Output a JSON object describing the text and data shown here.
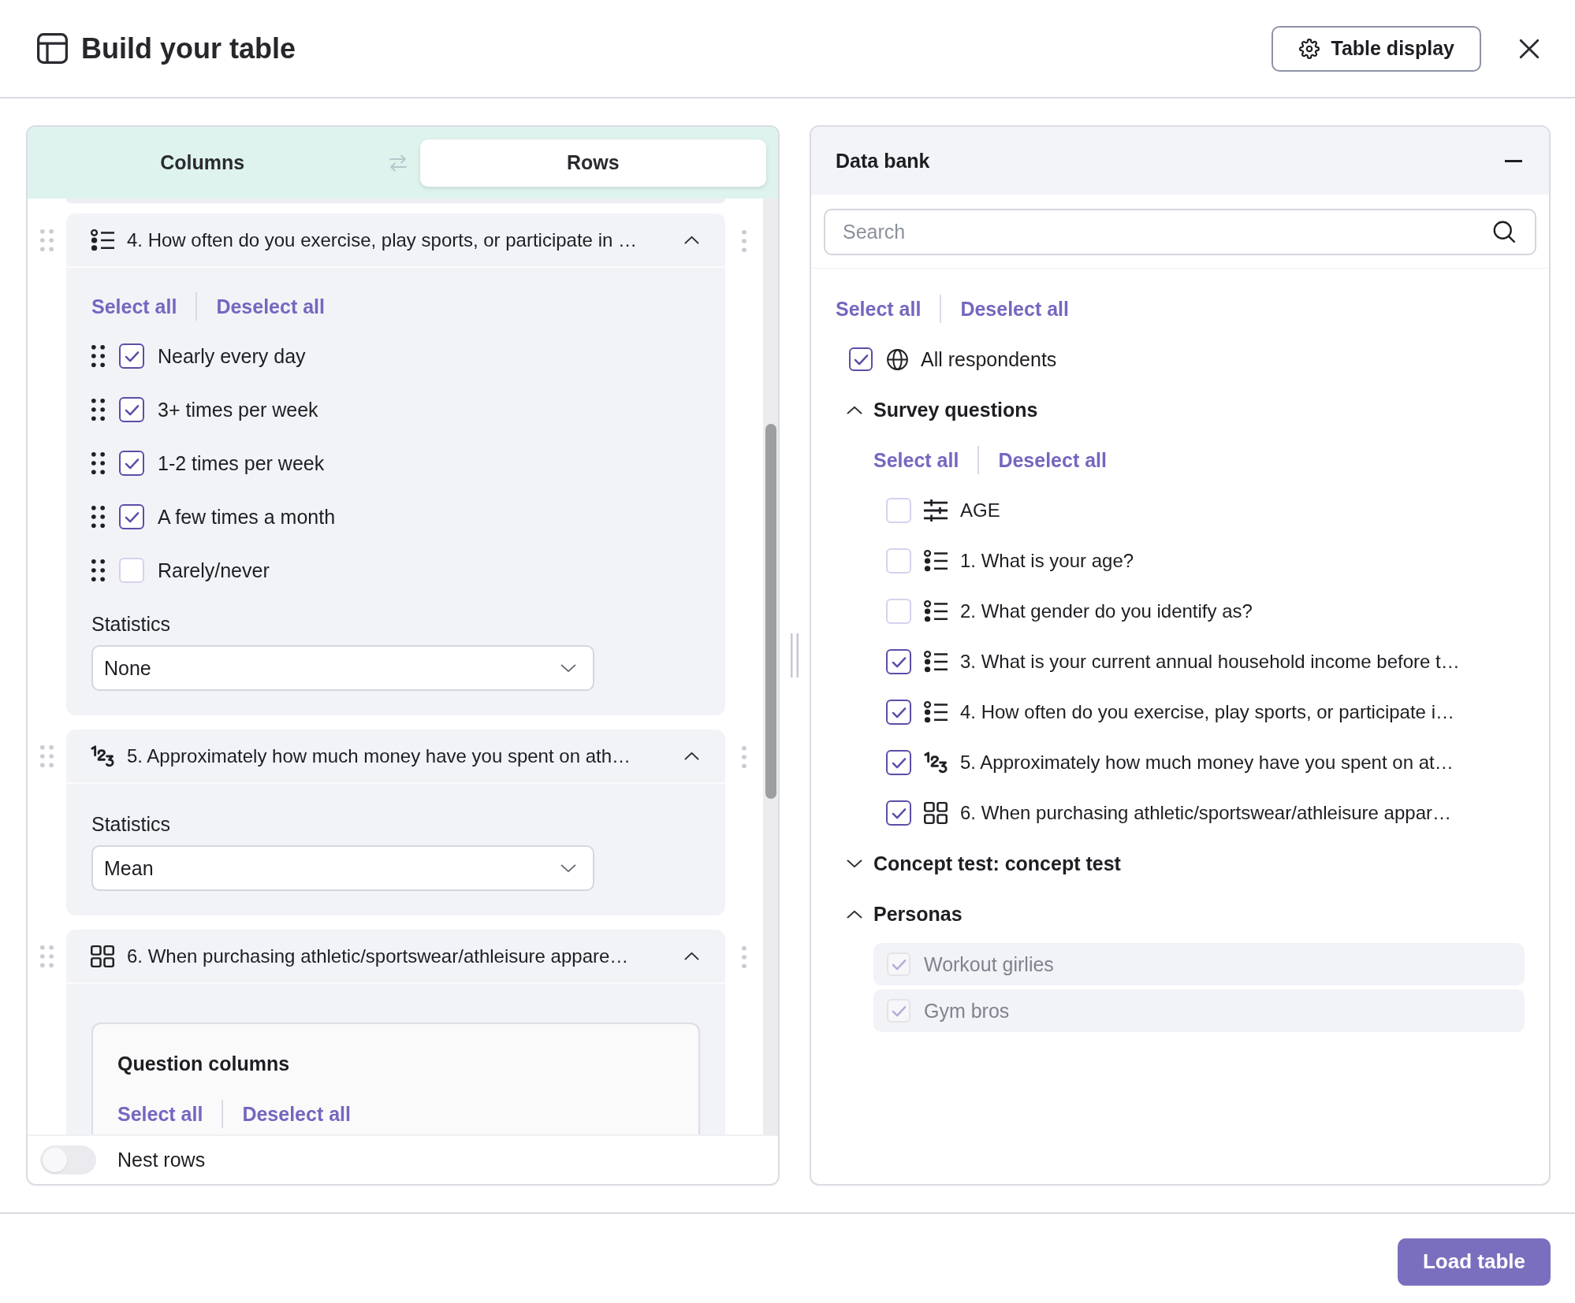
{
  "header": {
    "title": "Build your table",
    "table_display_button": "Table display"
  },
  "rows_panel": {
    "tabs": [
      {
        "label": "Columns",
        "selected": false
      },
      {
        "label": "Rows",
        "selected": true
      }
    ],
    "questions": [
      {
        "kind": "multiple_choice",
        "title": "4. How often do you exercise, play sports, or participate in …",
        "expanded": true,
        "select_all": "Select all",
        "deselect_all": "Deselect all",
        "options": [
          {
            "label": "Nearly every day",
            "checked": true
          },
          {
            "label": "3+ times per week",
            "checked": true
          },
          {
            "label": "1-2 times per week",
            "checked": true
          },
          {
            "label": "A few times a month",
            "checked": true
          },
          {
            "label": "Rarely/never",
            "checked": false
          }
        ],
        "statistics": {
          "label": "Statistics",
          "value": "None"
        }
      },
      {
        "kind": "numeric",
        "title": "5. Approximately how much money have you spent on ath…",
        "expanded": true,
        "statistics": {
          "label": "Statistics",
          "value": "Mean"
        }
      },
      {
        "kind": "grid",
        "title": "6. When purchasing athletic/sportswear/athleisure appare…",
        "expanded": true,
        "question_columns": {
          "title": "Question columns",
          "select_all": "Select all",
          "deselect_all": "Deselect all"
        }
      }
    ],
    "nest_rows": {
      "label": "Nest rows",
      "on": false
    }
  },
  "data_bank": {
    "title": "Data bank",
    "search": {
      "placeholder": "Search"
    },
    "select_all": "Select all",
    "deselect_all": "Deselect all",
    "all_respondents": {
      "label": "All respondents",
      "checked": true
    },
    "groups": [
      {
        "title": "Survey questions",
        "expanded": true,
        "select_all": "Select all",
        "deselect_all": "Deselect all",
        "items": [
          {
            "kind": "variable",
            "label": "AGE",
            "checked": false
          },
          {
            "kind": "multiple_choice",
            "label": "1. What is your age?",
            "checked": false
          },
          {
            "kind": "multiple_choice",
            "label": "2. What gender do you identify as?",
            "checked": false
          },
          {
            "kind": "multiple_choice",
            "label": "3. What is your current annual household income before t…",
            "checked": true
          },
          {
            "kind": "multiple_choice",
            "label": "4. How often do you exercise, play sports, or participate i…",
            "checked": true
          },
          {
            "kind": "numeric",
            "label": "5. Approximately how much money have you spent on at…",
            "checked": true
          },
          {
            "kind": "grid",
            "label": "6. When purchasing athletic/sportswear/athleisure appar…",
            "checked": true
          }
        ]
      },
      {
        "title": "Concept test: concept test",
        "expanded": false
      },
      {
        "title": "Personas",
        "expanded": true,
        "items": [
          {
            "kind": "persona",
            "label": "Workout girlies",
            "checked": true,
            "disabled": true
          },
          {
            "kind": "persona",
            "label": "Gym bros",
            "checked": true,
            "disabled": true
          }
        ]
      }
    ]
  },
  "footer": {
    "load_button": "Load table"
  }
}
